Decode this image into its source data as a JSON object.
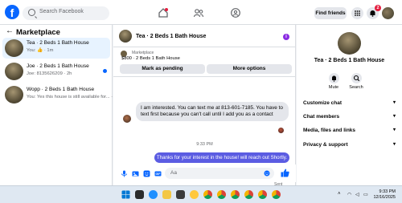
{
  "topbar": {
    "search_placeholder": "Search Facebook",
    "find_friends_label": "Find friends",
    "notification_count": "2"
  },
  "sidebar": {
    "title": "Marketplace",
    "conversations": [
      {
        "title": "Tea · 2 Beds 1 Bath House",
        "sub": "You: 👍 · 1m"
      },
      {
        "title": "Joe · 2 Beds 1 Bath House",
        "sub": "Joe: 8135626209 · 2h"
      },
      {
        "title": "Wopp · 2 Beds 1 Bath House",
        "sub": "You: Yes this house is still available for... · 2h"
      }
    ]
  },
  "chat": {
    "title": "Tea · 2 Beds 1 Bath House",
    "listing_label": "Marketplace",
    "listing_price": "$800 · 2 Beds 1 Bath House",
    "mark_pending_label": "Mark as pending",
    "more_options_label": "More options",
    "incoming_message": "I am interested. You can text me at 813-601-7185. You have to text first because you can't call until I add you as a contact",
    "timestamp": "9:33 PM",
    "outgoing_message": "Thanks for your interest in the house! will reach out Shortly.",
    "sent_label": "Sent",
    "composer_placeholder": "Aa"
  },
  "details": {
    "title": "Tea · 2 Beds 1 Bath House",
    "mute_label": "Mute",
    "search_label": "Search",
    "sections": [
      "Customize chat",
      "Chat members",
      "Media, files and links",
      "Privacy & support"
    ]
  },
  "taskbar": {
    "time": "9:33 PM",
    "date": "12/16/2025"
  },
  "colors": {
    "brand": "#0866ff",
    "outgoing_bubble": "#5b5ce2",
    "badge": "#e41e3f"
  }
}
